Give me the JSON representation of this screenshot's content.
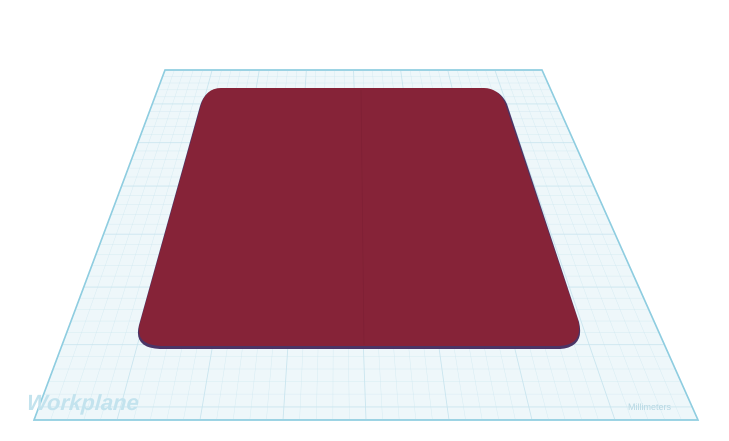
{
  "workplane": {
    "label": "Workplane",
    "units_label": "Millimeters",
    "surface_color": "#eef7fa",
    "grid_color": "#c7e4ee",
    "border_color": "#8fcde0"
  },
  "shape": {
    "color": "#862338",
    "edge_color": "#4a3a6a",
    "type": "box"
  }
}
